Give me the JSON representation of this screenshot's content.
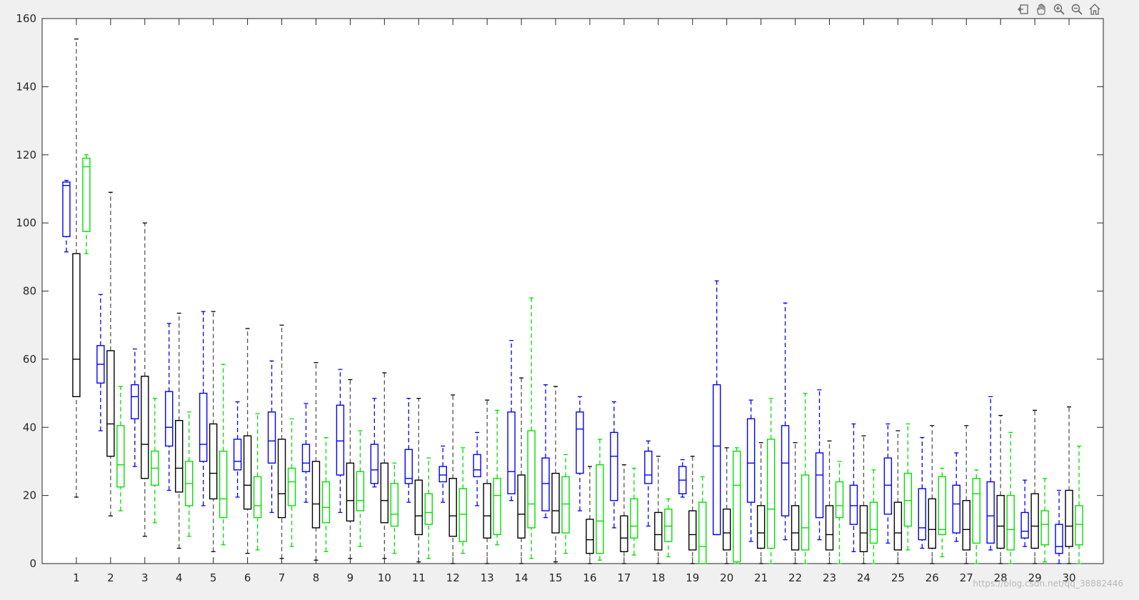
{
  "toolbar": {
    "buttons": [
      {
        "name": "export-icon"
      },
      {
        "name": "pan-hand-icon"
      },
      {
        "name": "zoom-in-icon"
      },
      {
        "name": "zoom-out-icon"
      },
      {
        "name": "home-icon"
      }
    ],
    "color": "#666666"
  },
  "watermark": "https://blog.csdn.net/qq_38882446",
  "chart_data": {
    "type": "box",
    "ylim": [
      0,
      160
    ],
    "yticks": [
      0,
      20,
      40,
      60,
      80,
      100,
      120,
      140,
      160
    ],
    "categories": [
      "1",
      "2",
      "3",
      "4",
      "5",
      "6",
      "7",
      "8",
      "9",
      "10",
      "11",
      "12",
      "13",
      "14",
      "15",
      "16",
      "17",
      "18",
      "19",
      "20",
      "21",
      "22",
      "23",
      "24",
      "25",
      "26",
      "27",
      "28",
      "29",
      "30"
    ],
    "series_colors": [
      "#0000ff",
      "#000000",
      "#00e000"
    ],
    "whisker_color_black": "#555555",
    "series": [
      {
        "color": "#0000ff",
        "boxes": [
          {
            "lo": 91.5,
            "q1": 96,
            "med": 111,
            "q3": 112,
            "hi": 112.5
          },
          {
            "lo": 39,
            "q1": 53,
            "med": 58.5,
            "q3": 64,
            "hi": 79
          },
          {
            "lo": 28.5,
            "q1": 42.5,
            "med": 49,
            "q3": 52.5,
            "hi": 63
          },
          {
            "lo": 21.5,
            "q1": 34.5,
            "med": 40,
            "q3": 50.5,
            "hi": 70.5
          },
          {
            "lo": 17,
            "q1": 30,
            "med": 35,
            "q3": 50,
            "hi": 74
          },
          {
            "lo": 19.5,
            "q1": 27.5,
            "med": 30,
            "q3": 36.5,
            "hi": 47.5
          },
          {
            "lo": 15,
            "q1": 29.5,
            "med": 36,
            "q3": 44.5,
            "hi": 59.5
          },
          {
            "lo": 18,
            "q1": 27,
            "med": 29.5,
            "q3": 35,
            "hi": 47
          },
          {
            "lo": 15,
            "q1": 26,
            "med": 36,
            "q3": 46.5,
            "hi": 57
          },
          {
            "lo": 22.5,
            "q1": 23.5,
            "med": 27.5,
            "q3": 35,
            "hi": 48.5
          },
          {
            "lo": 18,
            "q1": 23.5,
            "med": 25,
            "q3": 33.5,
            "hi": 48.5
          },
          {
            "lo": 18,
            "q1": 24,
            "med": 26,
            "q3": 28.5,
            "hi": 34.5
          },
          {
            "lo": 17,
            "q1": 25.5,
            "med": 27.5,
            "q3": 32,
            "hi": 38.5
          },
          {
            "lo": 18.5,
            "q1": 20.5,
            "med": 27,
            "q3": 44.5,
            "hi": 65.5
          },
          {
            "lo": 13.5,
            "q1": 15.5,
            "med": 23.5,
            "q3": 31,
            "hi": 52.5
          },
          {
            "lo": 15.5,
            "q1": 26.5,
            "med": 39.5,
            "q3": 44.5,
            "hi": 49
          },
          {
            "lo": 10.5,
            "q1": 18.5,
            "med": 31.5,
            "q3": 38.5,
            "hi": 47.5
          },
          {
            "lo": 11,
            "q1": 23.5,
            "med": 26,
            "q3": 33,
            "hi": 36
          },
          {
            "lo": 19.5,
            "q1": 20.5,
            "med": 24.5,
            "q3": 28.5,
            "hi": 30.5
          },
          {
            "lo": 8.5,
            "q1": 8.5,
            "med": 34.5,
            "q3": 52.5,
            "hi": 83
          },
          {
            "lo": 6.5,
            "q1": 18,
            "med": 29.5,
            "q3": 42.5,
            "hi": 48
          },
          {
            "lo": 7,
            "q1": 14,
            "med": 29.5,
            "q3": 40.5,
            "hi": 76.5
          },
          {
            "lo": 7,
            "q1": 13.5,
            "med": 26,
            "q3": 32.5,
            "hi": 51
          },
          {
            "lo": 3.5,
            "q1": 11.5,
            "med": 17,
            "q3": 23,
            "hi": 41
          },
          {
            "lo": 6,
            "q1": 14.5,
            "med": 23,
            "q3": 31,
            "hi": 41
          },
          {
            "lo": 4.5,
            "q1": 7,
            "med": 10.5,
            "q3": 22,
            "hi": 37
          },
          {
            "lo": 6.5,
            "q1": 9,
            "med": 17.5,
            "q3": 23,
            "hi": 32.5
          },
          {
            "lo": 4,
            "q1": 6,
            "med": 14,
            "q3": 24,
            "hi": 49
          },
          {
            "lo": 5,
            "q1": 7.5,
            "med": 9.5,
            "q3": 15,
            "hi": 24.5
          },
          {
            "lo": 0,
            "q1": 3,
            "med": 5,
            "q3": 11.5,
            "hi": 21.5
          }
        ]
      },
      {
        "color": "#000000",
        "boxes": [
          {
            "lo": 19.5,
            "q1": 49,
            "med": 60,
            "q3": 91,
            "hi": 154
          },
          {
            "lo": 14,
            "q1": 31.5,
            "med": 41,
            "q3": 62.5,
            "hi": 109
          },
          {
            "lo": 8,
            "q1": 25,
            "med": 35,
            "q3": 55,
            "hi": 100
          },
          {
            "lo": 4.5,
            "q1": 21,
            "med": 28,
            "q3": 42,
            "hi": 73.5
          },
          {
            "lo": 3.5,
            "q1": 19,
            "med": 26.5,
            "q3": 41,
            "hi": 74
          },
          {
            "lo": 3,
            "q1": 16,
            "med": 23,
            "q3": 37.5,
            "hi": 69
          },
          {
            "lo": 1.5,
            "q1": 13.5,
            "med": 20.5,
            "q3": 36.5,
            "hi": 70
          },
          {
            "lo": 1,
            "q1": 10.5,
            "med": 17.5,
            "q3": 30,
            "hi": 59
          },
          {
            "lo": 1.5,
            "q1": 12.5,
            "med": 18.5,
            "q3": 29.5,
            "hi": 54
          },
          {
            "lo": 1.5,
            "q1": 12,
            "med": 18.5,
            "q3": 29.5,
            "hi": 56
          },
          {
            "lo": 0.5,
            "q1": 8.5,
            "med": 14,
            "q3": 24.5,
            "hi": 48.5
          },
          {
            "lo": 0,
            "q1": 8,
            "med": 14,
            "q3": 25,
            "hi": 49.5
          },
          {
            "lo": 0,
            "q1": 7.5,
            "med": 14,
            "q3": 23.5,
            "hi": 48
          },
          {
            "lo": 0,
            "q1": 7.5,
            "med": 14.5,
            "q3": 26,
            "hi": 54.5
          },
          {
            "lo": 0.5,
            "q1": 9,
            "med": 15.5,
            "q3": 26.5,
            "hi": 52
          },
          {
            "lo": 0,
            "q1": 3,
            "med": 7,
            "q3": 13,
            "hi": 28.5
          },
          {
            "lo": 0,
            "q1": 3.5,
            "med": 7.5,
            "q3": 14,
            "hi": 29
          },
          {
            "lo": 0,
            "q1": 4,
            "med": 8.5,
            "q3": 15,
            "hi": 31.5
          },
          {
            "lo": 0,
            "q1": 4,
            "med": 8.5,
            "q3": 15.5,
            "hi": 31.5
          },
          {
            "lo": 0,
            "q1": 4,
            "med": 9,
            "q3": 16,
            "hi": 34
          },
          {
            "lo": 0,
            "q1": 4.5,
            "med": 9,
            "q3": 17,
            "hi": 35.5
          },
          {
            "lo": 0,
            "q1": 4,
            "med": 9,
            "q3": 17,
            "hi": 35.5
          },
          {
            "lo": 0,
            "q1": 4,
            "med": 8.5,
            "q3": 17,
            "hi": 36
          },
          {
            "lo": 0,
            "q1": 3.5,
            "med": 9,
            "q3": 17,
            "hi": 37.5
          },
          {
            "lo": 0,
            "q1": 4,
            "med": 9,
            "q3": 18,
            "hi": 39
          },
          {
            "lo": 0,
            "q1": 4.5,
            "med": 10,
            "q3": 19,
            "hi": 40.5
          },
          {
            "lo": 0,
            "q1": 4,
            "med": 10,
            "q3": 18.5,
            "hi": 40.5
          },
          {
            "lo": 0,
            "q1": 4.5,
            "med": 11,
            "q3": 20,
            "hi": 43.5
          },
          {
            "lo": 0,
            "q1": 4.5,
            "med": 11,
            "q3": 20.5,
            "hi": 45
          },
          {
            "lo": 0,
            "q1": 5,
            "med": 11,
            "q3": 21.5,
            "hi": 46
          }
        ]
      },
      {
        "color": "#00e000",
        "boxes": [
          {
            "lo": 91,
            "q1": 97.5,
            "med": 116.5,
            "q3": 119,
            "hi": 120
          },
          {
            "lo": 15.5,
            "q1": 22.5,
            "med": 29,
            "q3": 40.5,
            "hi": 52
          },
          {
            "lo": 12,
            "q1": 23,
            "med": 28,
            "q3": 33,
            "hi": 48.5
          },
          {
            "lo": 8,
            "q1": 17,
            "med": 23.5,
            "q3": 30,
            "hi": 44.5
          },
          {
            "lo": 5.5,
            "q1": 13.5,
            "med": 19,
            "q3": 33,
            "hi": 58.5
          },
          {
            "lo": 4,
            "q1": 13.5,
            "med": 17,
            "q3": 25.5,
            "hi": 44
          },
          {
            "lo": 5,
            "q1": 17,
            "med": 24,
            "q3": 28,
            "hi": 42.5
          },
          {
            "lo": 3.5,
            "q1": 12,
            "med": 16.5,
            "q3": 24,
            "hi": 37
          },
          {
            "lo": 5,
            "q1": 15.5,
            "med": 18.5,
            "q3": 27,
            "hi": 39
          },
          {
            "lo": 3,
            "q1": 11,
            "med": 14.5,
            "q3": 23.5,
            "hi": 29.5
          },
          {
            "lo": 1.5,
            "q1": 11.5,
            "med": 15,
            "q3": 20.5,
            "hi": 31
          },
          {
            "lo": 3,
            "q1": 6.5,
            "med": 14.5,
            "q3": 22,
            "hi": 34
          },
          {
            "lo": 5.5,
            "q1": 8.5,
            "med": 20,
            "q3": 25,
            "hi": 45
          },
          {
            "lo": 1.5,
            "q1": 10.5,
            "med": 17.5,
            "q3": 39,
            "hi": 78
          },
          {
            "lo": 3,
            "q1": 9,
            "med": 17.5,
            "q3": 25.5,
            "hi": 32
          },
          {
            "lo": 1,
            "q1": 3,
            "med": 12.5,
            "q3": 29,
            "hi": 36.5
          },
          {
            "lo": 2.5,
            "q1": 7.5,
            "med": 11,
            "q3": 19,
            "hi": 28
          },
          {
            "lo": 2,
            "q1": 6.5,
            "med": 11,
            "q3": 16,
            "hi": 19
          },
          {
            "lo": 0,
            "q1": 0,
            "med": 5,
            "q3": 18,
            "hi": 25.5
          },
          {
            "lo": 0,
            "q1": 0.5,
            "med": 23,
            "q3": 33,
            "hi": 34
          },
          {
            "lo": 0,
            "q1": 4.5,
            "med": 16,
            "q3": 36.5,
            "hi": 48.5
          },
          {
            "lo": 0,
            "q1": 4,
            "med": 10.5,
            "q3": 26,
            "hi": 50
          },
          {
            "lo": 0,
            "q1": 13.5,
            "med": 17,
            "q3": 24,
            "hi": 30
          },
          {
            "lo": 0,
            "q1": 6,
            "med": 10,
            "q3": 18,
            "hi": 27.5
          },
          {
            "lo": 4,
            "q1": 11,
            "med": 18.5,
            "q3": 26.5,
            "hi": 41
          },
          {
            "lo": 2,
            "q1": 8.5,
            "med": 10,
            "q3": 25.5,
            "hi": 28
          },
          {
            "lo": 0,
            "q1": 6,
            "med": 20.5,
            "q3": 25,
            "hi": 27.5
          },
          {
            "lo": 0,
            "q1": 4,
            "med": 10,
            "q3": 20,
            "hi": 38.5
          },
          {
            "lo": 0.5,
            "q1": 5.5,
            "med": 11.5,
            "q3": 15.5,
            "hi": 25
          },
          {
            "lo": 0,
            "q1": 5.5,
            "med": 11.5,
            "q3": 17,
            "hi": 34.5
          }
        ]
      }
    ]
  }
}
